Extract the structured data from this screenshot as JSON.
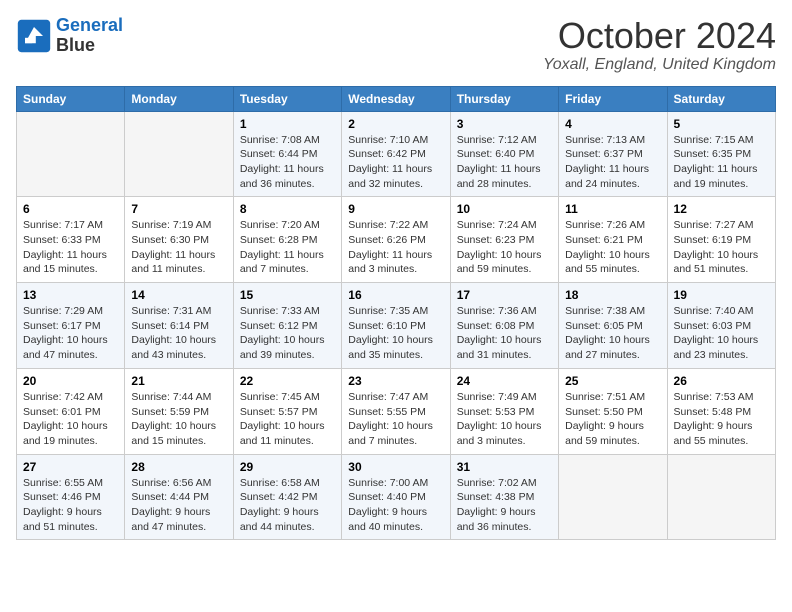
{
  "header": {
    "logo_line1": "General",
    "logo_line2": "Blue",
    "month": "October 2024",
    "location": "Yoxall, England, United Kingdom"
  },
  "weekdays": [
    "Sunday",
    "Monday",
    "Tuesday",
    "Wednesday",
    "Thursday",
    "Friday",
    "Saturday"
  ],
  "weeks": [
    [
      {
        "day": "",
        "sunrise": "",
        "sunset": "",
        "daylight": ""
      },
      {
        "day": "",
        "sunrise": "",
        "sunset": "",
        "daylight": ""
      },
      {
        "day": "1",
        "sunrise": "Sunrise: 7:08 AM",
        "sunset": "Sunset: 6:44 PM",
        "daylight": "Daylight: 11 hours and 36 minutes."
      },
      {
        "day": "2",
        "sunrise": "Sunrise: 7:10 AM",
        "sunset": "Sunset: 6:42 PM",
        "daylight": "Daylight: 11 hours and 32 minutes."
      },
      {
        "day": "3",
        "sunrise": "Sunrise: 7:12 AM",
        "sunset": "Sunset: 6:40 PM",
        "daylight": "Daylight: 11 hours and 28 minutes."
      },
      {
        "day": "4",
        "sunrise": "Sunrise: 7:13 AM",
        "sunset": "Sunset: 6:37 PM",
        "daylight": "Daylight: 11 hours and 24 minutes."
      },
      {
        "day": "5",
        "sunrise": "Sunrise: 7:15 AM",
        "sunset": "Sunset: 6:35 PM",
        "daylight": "Daylight: 11 hours and 19 minutes."
      }
    ],
    [
      {
        "day": "6",
        "sunrise": "Sunrise: 7:17 AM",
        "sunset": "Sunset: 6:33 PM",
        "daylight": "Daylight: 11 hours and 15 minutes."
      },
      {
        "day": "7",
        "sunrise": "Sunrise: 7:19 AM",
        "sunset": "Sunset: 6:30 PM",
        "daylight": "Daylight: 11 hours and 11 minutes."
      },
      {
        "day": "8",
        "sunrise": "Sunrise: 7:20 AM",
        "sunset": "Sunset: 6:28 PM",
        "daylight": "Daylight: 11 hours and 7 minutes."
      },
      {
        "day": "9",
        "sunrise": "Sunrise: 7:22 AM",
        "sunset": "Sunset: 6:26 PM",
        "daylight": "Daylight: 11 hours and 3 minutes."
      },
      {
        "day": "10",
        "sunrise": "Sunrise: 7:24 AM",
        "sunset": "Sunset: 6:23 PM",
        "daylight": "Daylight: 10 hours and 59 minutes."
      },
      {
        "day": "11",
        "sunrise": "Sunrise: 7:26 AM",
        "sunset": "Sunset: 6:21 PM",
        "daylight": "Daylight: 10 hours and 55 minutes."
      },
      {
        "day": "12",
        "sunrise": "Sunrise: 7:27 AM",
        "sunset": "Sunset: 6:19 PM",
        "daylight": "Daylight: 10 hours and 51 minutes."
      }
    ],
    [
      {
        "day": "13",
        "sunrise": "Sunrise: 7:29 AM",
        "sunset": "Sunset: 6:17 PM",
        "daylight": "Daylight: 10 hours and 47 minutes."
      },
      {
        "day": "14",
        "sunrise": "Sunrise: 7:31 AM",
        "sunset": "Sunset: 6:14 PM",
        "daylight": "Daylight: 10 hours and 43 minutes."
      },
      {
        "day": "15",
        "sunrise": "Sunrise: 7:33 AM",
        "sunset": "Sunset: 6:12 PM",
        "daylight": "Daylight: 10 hours and 39 minutes."
      },
      {
        "day": "16",
        "sunrise": "Sunrise: 7:35 AM",
        "sunset": "Sunset: 6:10 PM",
        "daylight": "Daylight: 10 hours and 35 minutes."
      },
      {
        "day": "17",
        "sunrise": "Sunrise: 7:36 AM",
        "sunset": "Sunset: 6:08 PM",
        "daylight": "Daylight: 10 hours and 31 minutes."
      },
      {
        "day": "18",
        "sunrise": "Sunrise: 7:38 AM",
        "sunset": "Sunset: 6:05 PM",
        "daylight": "Daylight: 10 hours and 27 minutes."
      },
      {
        "day": "19",
        "sunrise": "Sunrise: 7:40 AM",
        "sunset": "Sunset: 6:03 PM",
        "daylight": "Daylight: 10 hours and 23 minutes."
      }
    ],
    [
      {
        "day": "20",
        "sunrise": "Sunrise: 7:42 AM",
        "sunset": "Sunset: 6:01 PM",
        "daylight": "Daylight: 10 hours and 19 minutes."
      },
      {
        "day": "21",
        "sunrise": "Sunrise: 7:44 AM",
        "sunset": "Sunset: 5:59 PM",
        "daylight": "Daylight: 10 hours and 15 minutes."
      },
      {
        "day": "22",
        "sunrise": "Sunrise: 7:45 AM",
        "sunset": "Sunset: 5:57 PM",
        "daylight": "Daylight: 10 hours and 11 minutes."
      },
      {
        "day": "23",
        "sunrise": "Sunrise: 7:47 AM",
        "sunset": "Sunset: 5:55 PM",
        "daylight": "Daylight: 10 hours and 7 minutes."
      },
      {
        "day": "24",
        "sunrise": "Sunrise: 7:49 AM",
        "sunset": "Sunset: 5:53 PM",
        "daylight": "Daylight: 10 hours and 3 minutes."
      },
      {
        "day": "25",
        "sunrise": "Sunrise: 7:51 AM",
        "sunset": "Sunset: 5:50 PM",
        "daylight": "Daylight: 9 hours and 59 minutes."
      },
      {
        "day": "26",
        "sunrise": "Sunrise: 7:53 AM",
        "sunset": "Sunset: 5:48 PM",
        "daylight": "Daylight: 9 hours and 55 minutes."
      }
    ],
    [
      {
        "day": "27",
        "sunrise": "Sunrise: 6:55 AM",
        "sunset": "Sunset: 4:46 PM",
        "daylight": "Daylight: 9 hours and 51 minutes."
      },
      {
        "day": "28",
        "sunrise": "Sunrise: 6:56 AM",
        "sunset": "Sunset: 4:44 PM",
        "daylight": "Daylight: 9 hours and 47 minutes."
      },
      {
        "day": "29",
        "sunrise": "Sunrise: 6:58 AM",
        "sunset": "Sunset: 4:42 PM",
        "daylight": "Daylight: 9 hours and 44 minutes."
      },
      {
        "day": "30",
        "sunrise": "Sunrise: 7:00 AM",
        "sunset": "Sunset: 4:40 PM",
        "daylight": "Daylight: 9 hours and 40 minutes."
      },
      {
        "day": "31",
        "sunrise": "Sunrise: 7:02 AM",
        "sunset": "Sunset: 4:38 PM",
        "daylight": "Daylight: 9 hours and 36 minutes."
      },
      {
        "day": "",
        "sunrise": "",
        "sunset": "",
        "daylight": ""
      },
      {
        "day": "",
        "sunrise": "",
        "sunset": "",
        "daylight": ""
      }
    ]
  ]
}
